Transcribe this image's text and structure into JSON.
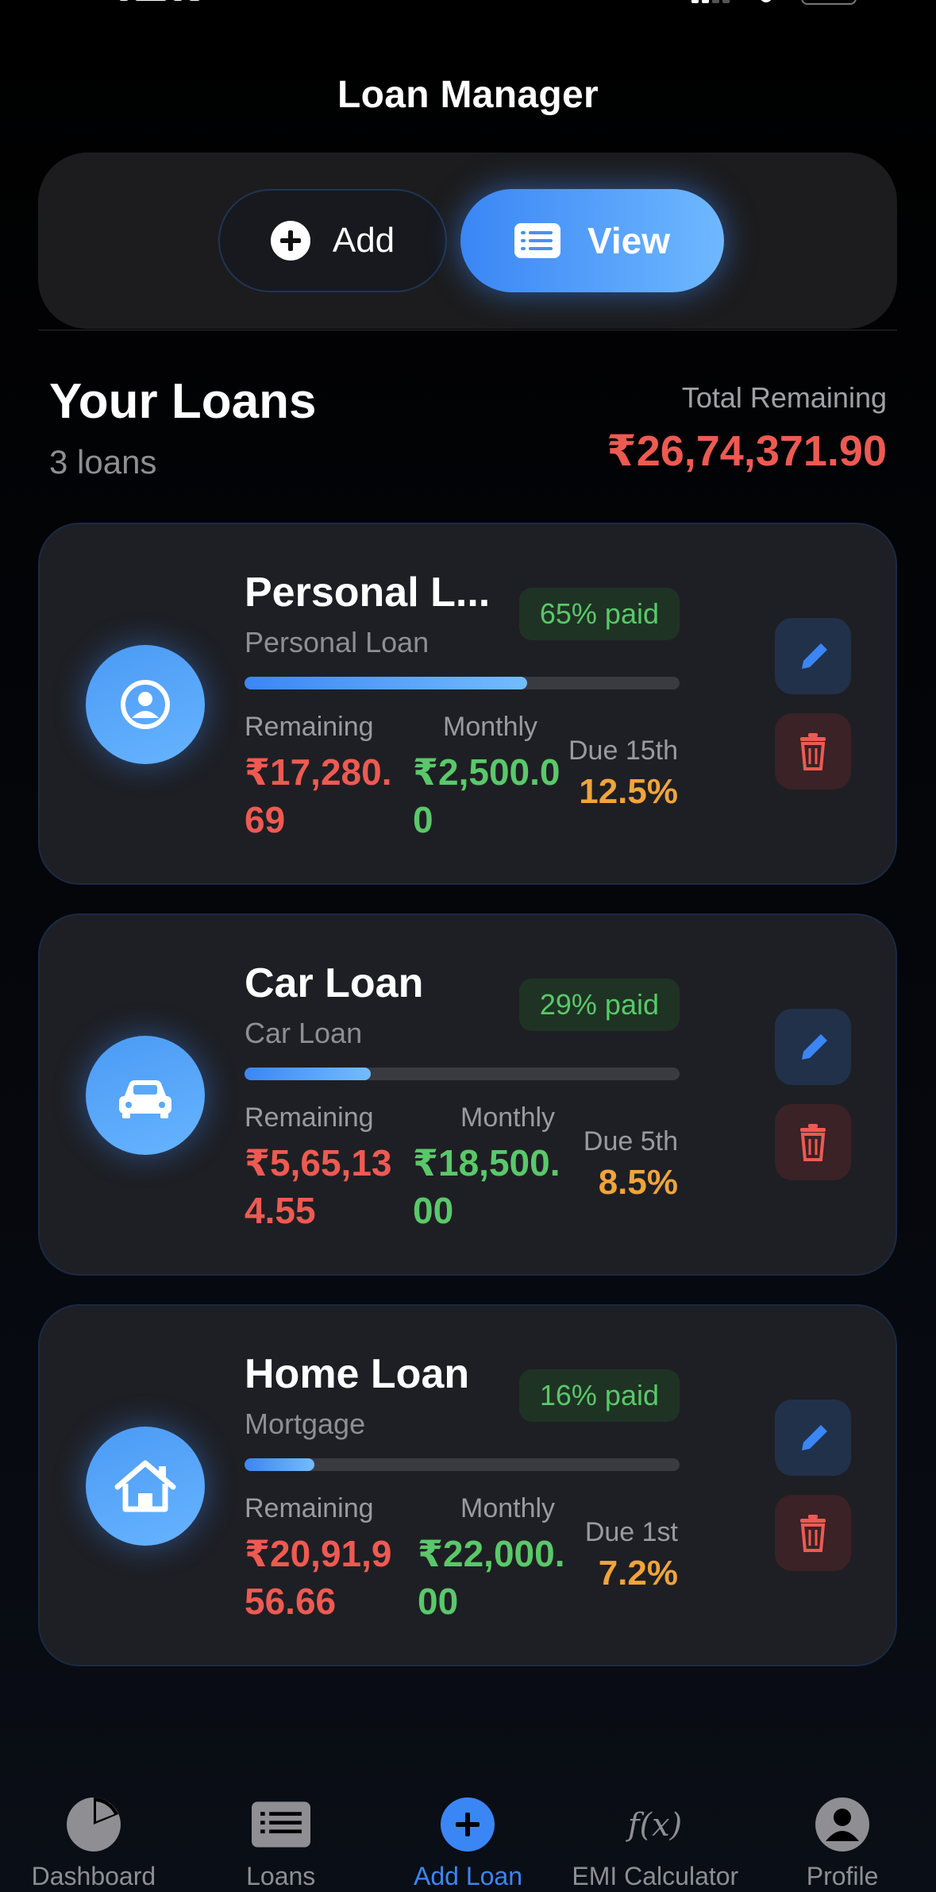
{
  "nav": {
    "title": "Loan Manager"
  },
  "segment": {
    "add_label": "Add",
    "view_label": "View",
    "selected": "View"
  },
  "summary": {
    "title": "Your Loans",
    "count": "3 loans",
    "total_label": "Total Remaining",
    "total_value": "₹26,74,371.90"
  },
  "labels": {
    "remaining": "Remaining",
    "monthly": "Monthly"
  },
  "loans": [
    {
      "name": "Personal L...",
      "type": "Personal Loan",
      "icon": "person-circle-icon",
      "paid_badge": "65% paid",
      "paid_fraction": 0.65,
      "remaining": "₹17,280.69",
      "monthly": "₹2,500.00",
      "due": "Due 15th",
      "rate": "12.5%"
    },
    {
      "name": "Car Loan",
      "type": "Car Loan",
      "icon": "car-icon",
      "paid_badge": "29% paid",
      "paid_fraction": 0.29,
      "remaining": "₹5,65,134.55",
      "monthly": "₹18,500.00",
      "due": "Due 5th",
      "rate": "8.5%"
    },
    {
      "name": "Home Loan",
      "type": "Mortgage",
      "icon": "house-icon",
      "paid_badge": "16% paid",
      "paid_fraction": 0.16,
      "remaining": "₹20,91,956.66",
      "monthly": "₹22,000.00",
      "due": "Due 1st",
      "rate": "7.2%"
    }
  ],
  "tabs": [
    {
      "label": "Dashboard",
      "icon": "pie-chart-icon",
      "active": false
    },
    {
      "label": "Loans",
      "icon": "list-icon",
      "active": false
    },
    {
      "label": "Add Loan",
      "icon": "plus-circle-icon",
      "active": true
    },
    {
      "label": "EMI Calculator",
      "icon": "function-icon",
      "active": false
    },
    {
      "label": "Profile",
      "icon": "person-icon",
      "active": false
    }
  ],
  "colors": {
    "accent": "#3a86f5",
    "remaining": "#ee5a52",
    "monthly": "#5ac86a",
    "rate": "#f0a43a",
    "background": "#000000",
    "card": "#1e1f24"
  }
}
